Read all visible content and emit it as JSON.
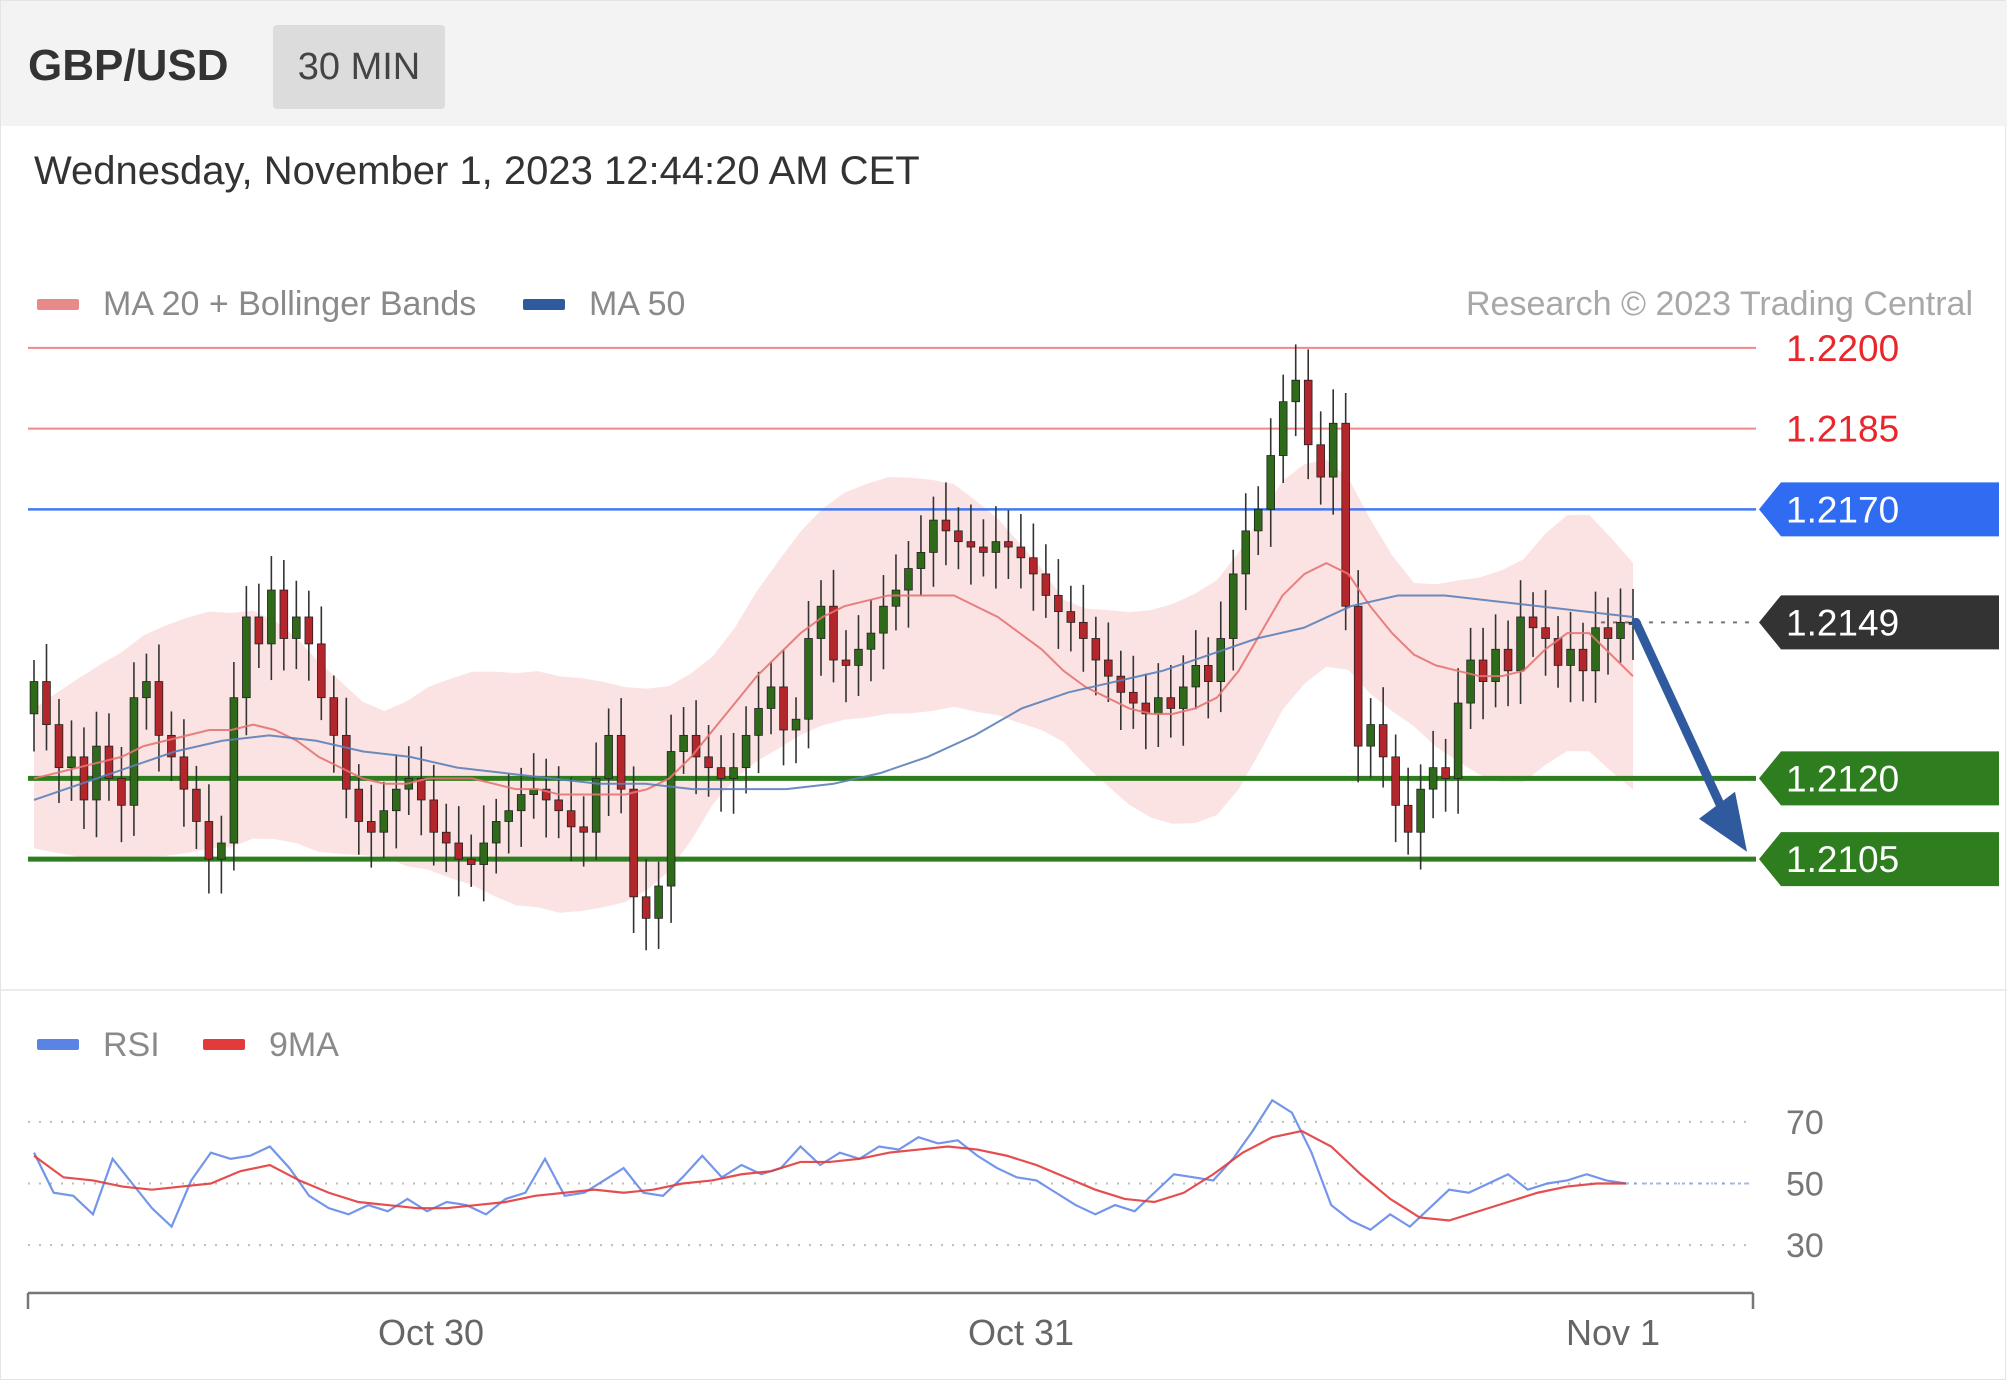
{
  "header": {
    "pair": "GBP/USD",
    "timeframe": "30 MIN"
  },
  "datetime": "Wednesday, November 1, 2023 12:44:20 AM CET",
  "legend": {
    "ma20": "MA 20 + Bollinger Bands",
    "ma50": "MA 50",
    "copyright": "Research © 2023 Trading Central"
  },
  "rsi_legend": {
    "rsi": "RSI",
    "ma9": "9MA"
  },
  "colors": {
    "resistance": "#e8262b",
    "pivot": "#2f6cf2",
    "support": "#2e7d1e",
    "current": "#333333",
    "ma20": "#e57373",
    "ma50": "#5b7fb8",
    "bollinger_fill": "#fbdede",
    "candle_up": "#2f6a1b",
    "candle_down": "#b3262b",
    "rsi": "#5b83e6",
    "rsi_ma": "#e23b3b",
    "arrow": "#2f5a9e"
  },
  "chart_data": [
    {
      "type": "candlestick",
      "title": "GBP/USD",
      "ylim": [
        1.2087,
        1.2205
      ],
      "x_ticks": [
        "Oct 30",
        "Oct 31",
        "Nov 1"
      ],
      "levels": [
        {
          "label": "1.2200",
          "value": 1.22,
          "kind": "resistance"
        },
        {
          "label": "1.2185",
          "value": 1.2185,
          "kind": "resistance"
        },
        {
          "label": "1.2170",
          "value": 1.217,
          "kind": "pivot"
        },
        {
          "label": "1.2149",
          "value": 1.2149,
          "kind": "current"
        },
        {
          "label": "1.2120",
          "value": 1.212,
          "kind": "support"
        },
        {
          "label": "1.2105",
          "value": 1.2105,
          "kind": "support"
        }
      ],
      "close": [
        1.2138,
        1.213,
        1.2122,
        1.2124,
        1.2116,
        1.2126,
        1.212,
        1.2115,
        1.2135,
        1.2138,
        1.2128,
        1.2124,
        1.2118,
        1.2112,
        1.2105,
        1.2108,
        1.2135,
        1.215,
        1.2145,
        1.2155,
        1.2146,
        1.215,
        1.2145,
        1.2135,
        1.2128,
        1.2118,
        1.2112,
        1.211,
        1.2114,
        1.2118,
        1.212,
        1.2116,
        1.211,
        1.2108,
        1.2105,
        1.2104,
        1.2108,
        1.2112,
        1.2114,
        1.2117,
        1.2118,
        1.2116,
        1.2114,
        1.2111,
        1.211,
        1.212,
        1.2128,
        1.2118,
        1.2098,
        1.2094,
        1.21,
        1.2125,
        1.2128,
        1.2124,
        1.2122,
        1.212,
        1.2122,
        1.2128,
        1.2133,
        1.2137,
        1.2129,
        1.2131,
        1.2146,
        1.2152,
        1.2142,
        1.2141,
        1.2144,
        1.2147,
        1.2152,
        1.2155,
        1.2159,
        1.2162,
        1.2168,
        1.2166,
        1.2164,
        1.2163,
        1.2162,
        1.2164,
        1.2163,
        1.2161,
        1.2158,
        1.2154,
        1.2151,
        1.2149,
        1.2146,
        1.2142,
        1.2139,
        1.2136,
        1.2134,
        1.2132,
        1.2135,
        1.2133,
        1.2137,
        1.2141,
        1.2138,
        1.2146,
        1.2158,
        1.2166,
        1.217,
        1.218,
        1.219,
        1.2194,
        1.2182,
        1.2176,
        1.2186,
        1.2152,
        1.2126,
        1.213,
        1.2124,
        1.2115,
        1.211,
        1.2118,
        1.2122,
        1.212,
        1.2134,
        1.2142,
        1.2138,
        1.2144,
        1.214,
        1.215,
        1.2148,
        1.2146,
        1.2141,
        1.2144,
        1.214,
        1.2148,
        1.2146,
        1.2149,
        1.2149
      ],
      "ma20": [
        1.212,
        1.2121,
        1.2122,
        1.2123,
        1.2124,
        1.2126,
        1.2127,
        1.2128,
        1.2129,
        1.2129,
        1.213,
        1.2129,
        1.2127,
        1.2124,
        1.2122,
        1.212,
        1.2119,
        1.2119,
        1.212,
        1.212,
        1.212,
        1.2119,
        1.2118,
        1.2118,
        1.2117,
        1.2117,
        1.2117,
        1.2117,
        1.2118,
        1.212,
        1.2124,
        1.2129,
        1.2134,
        1.2139,
        1.2143,
        1.2147,
        1.215,
        1.2152,
        1.2153,
        1.2154,
        1.2154,
        1.2154,
        1.2154,
        1.2152,
        1.215,
        1.2147,
        1.2144,
        1.214,
        1.2137,
        1.2135,
        1.2133,
        1.2132,
        1.2132,
        1.2133,
        1.2135,
        1.214,
        1.2147,
        1.2154,
        1.2158,
        1.216,
        1.2158,
        1.2152,
        1.2147,
        1.2143,
        1.2141,
        1.214,
        1.2139,
        1.2139,
        1.214,
        1.2144,
        1.2147,
        1.2147,
        1.2143,
        1.2139
      ],
      "ma50": [
        1.2116,
        1.2119,
        1.2122,
        1.2125,
        1.2127,
        1.2128,
        1.2127,
        1.2125,
        1.2124,
        1.2122,
        1.2121,
        1.212,
        1.2119,
        1.2119,
        1.2118,
        1.2118,
        1.2118,
        1.2119,
        1.2121,
        1.2124,
        1.2128,
        1.2133,
        1.2136,
        1.2138,
        1.214,
        1.2143,
        1.2146,
        1.2148,
        1.2152,
        1.2154,
        1.2154,
        1.2153,
        1.2152,
        1.2151,
        1.215
      ]
    },
    {
      "type": "line",
      "title": "RSI",
      "ylim": [
        20,
        80
      ],
      "y_ticks": [
        "70",
        "50",
        "30"
      ],
      "series": [
        {
          "name": "RSI",
          "values": [
            60,
            47,
            46,
            40,
            58,
            50,
            42,
            36,
            51,
            60,
            58,
            59,
            62,
            55,
            46,
            42,
            40,
            43,
            41,
            45,
            41,
            44,
            43,
            40,
            45,
            47,
            58,
            46,
            47,
            51,
            55,
            47,
            46,
            52,
            59,
            52,
            56,
            53,
            55,
            62,
            56,
            60,
            58,
            62,
            61,
            65,
            63,
            64,
            59,
            55,
            52,
            51,
            47,
            43,
            40,
            43,
            41,
            47,
            53,
            52,
            51,
            58,
            67,
            77,
            73,
            60,
            43,
            38,
            35,
            40,
            36,
            42,
            48,
            47,
            50,
            53,
            48,
            50,
            51,
            53,
            51,
            50
          ]
        },
        {
          "name": "9MA",
          "values": [
            59,
            52,
            51,
            49,
            48,
            49,
            50,
            54,
            56,
            51,
            47,
            44,
            43,
            42,
            42,
            43,
            44,
            46,
            47,
            48,
            47,
            48,
            50,
            51,
            53,
            54,
            57,
            57,
            58,
            60,
            61,
            62,
            61,
            59,
            56,
            52,
            48,
            45,
            44,
            47,
            53,
            60,
            65,
            67,
            62,
            53,
            45,
            39,
            38,
            41,
            44,
            47,
            49,
            50,
            50
          ]
        }
      ]
    }
  ]
}
